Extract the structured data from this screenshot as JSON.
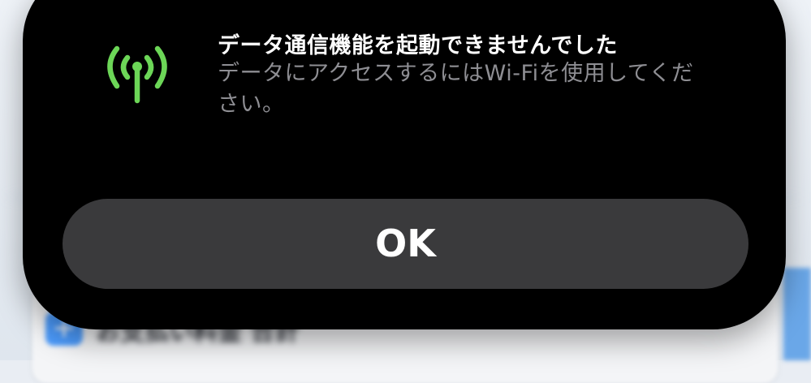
{
  "background": {
    "card_icon": "+",
    "card_text": "お支払い料金 合計"
  },
  "alert": {
    "icon": "cellular-antenna-icon",
    "icon_color": "#6cd657",
    "title": "データ通信機能を起動できませんでした",
    "message": "データにアクセスするにはWi-Fiを使用してください。",
    "button_label": "OK"
  }
}
